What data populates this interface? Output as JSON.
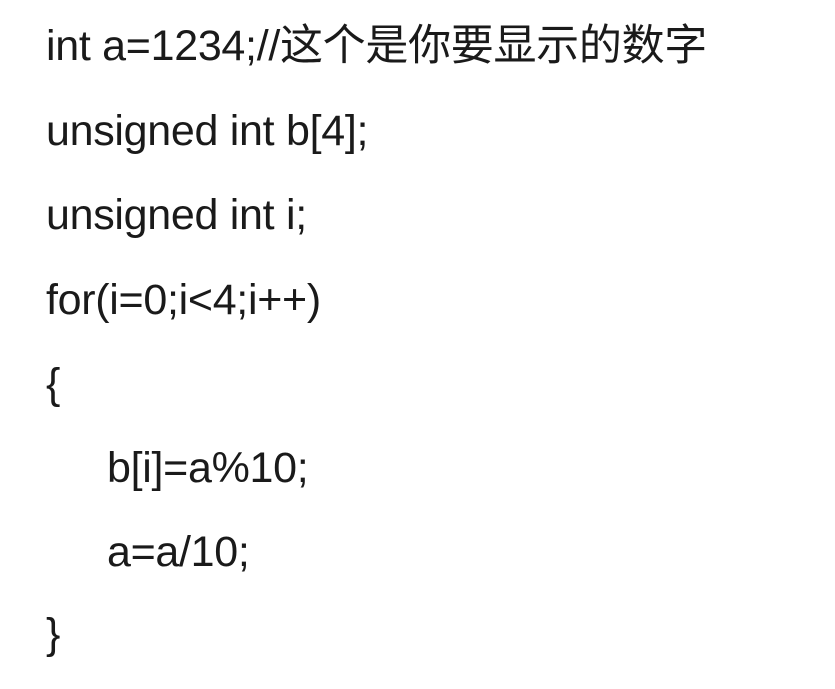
{
  "code": {
    "lines": [
      "int a=1234;//这个是你要显示的数字",
      "unsigned int b[4];",
      "unsigned int i;",
      "for(i=0;i<4;i++)",
      "{",
      "b[i]=a%10;",
      "a=a/10;",
      "}"
    ]
  }
}
